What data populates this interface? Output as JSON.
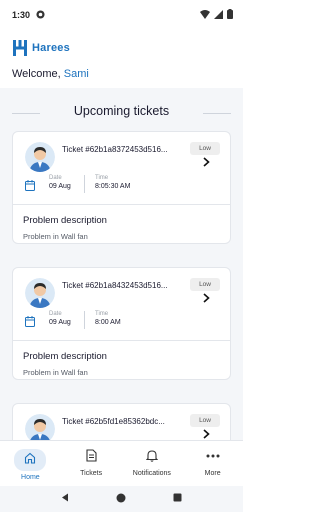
{
  "status_bar": {
    "time": "1:30"
  },
  "header": {
    "app_name": "Harees",
    "welcome_prefix": "Welcome,",
    "user_name": "Sami"
  },
  "section": {
    "title": "Upcoming tickets"
  },
  "tickets": [
    {
      "id_text": "Ticket #62b1a8372453d516...",
      "priority": "Low",
      "date_label": "Date",
      "date": "09 Aug",
      "time_label": "Time",
      "time": "8:05:30 AM",
      "problem_title": "Problem description",
      "problem_text": "Problem in Wall fan"
    },
    {
      "id_text": "Ticket #62b1a8432453d516...",
      "priority": "Low",
      "date_label": "Date",
      "date": "09 Aug",
      "time_label": "Time",
      "time": "8:00 AM",
      "problem_title": "Problem description",
      "problem_text": "Problem in Wall fan"
    },
    {
      "id_text": "Ticket #62b5fd1e85362bdc...",
      "priority": "Low"
    }
  ],
  "bottom_nav": {
    "items": [
      {
        "label": "Home",
        "icon": "home-icon",
        "active": true
      },
      {
        "label": "Tickets",
        "icon": "document-icon",
        "active": false
      },
      {
        "label": "Notifications",
        "icon": "bell-icon",
        "active": false
      },
      {
        "label": "More",
        "icon": "more-icon",
        "active": false
      }
    ]
  },
  "colors": {
    "accent": "#1e73be",
    "background": "#f4f6f9",
    "card": "#ffffff"
  }
}
